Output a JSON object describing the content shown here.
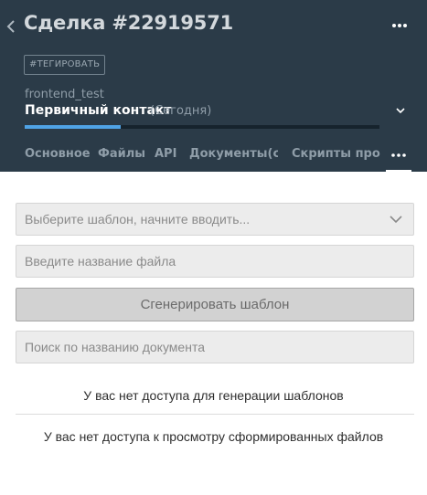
{
  "header": {
    "title": "Сделка #22919571",
    "tag_button_label": "#ТЕГИРОВАТЬ",
    "pipeline_name": "frontend_test",
    "stage_name": "Первичный контакт",
    "stage_date": "(Сегодня)",
    "stage_progress": 0.27,
    "progress_color": "#4fa3e6",
    "background_color": "#2b3b48"
  },
  "tabs": [
    {
      "label": "Основное"
    },
    {
      "label": "Файлы"
    },
    {
      "label": "API"
    },
    {
      "label": "Документы(сч"
    },
    {
      "label": "Скрипты прода"
    }
  ],
  "icons": {
    "back": "chevron-left-icon",
    "more": "more-horizontal-icon",
    "stage_dropdown": "chevron-down-icon",
    "template_dropdown": "chevron-down-icon"
  },
  "main": {
    "template_select_placeholder": "Выберите шаблон, начните вводить...",
    "filename_placeholder": "Введите название файла",
    "generate_button_label": "Сгенерировать шаблон",
    "search_placeholder": "Поиск по названию документа",
    "no_generate_access": "У вас нет доступа для генерации шаблонов",
    "no_view_access": "У вас нет доступа к просмотру сформированных файлов"
  }
}
